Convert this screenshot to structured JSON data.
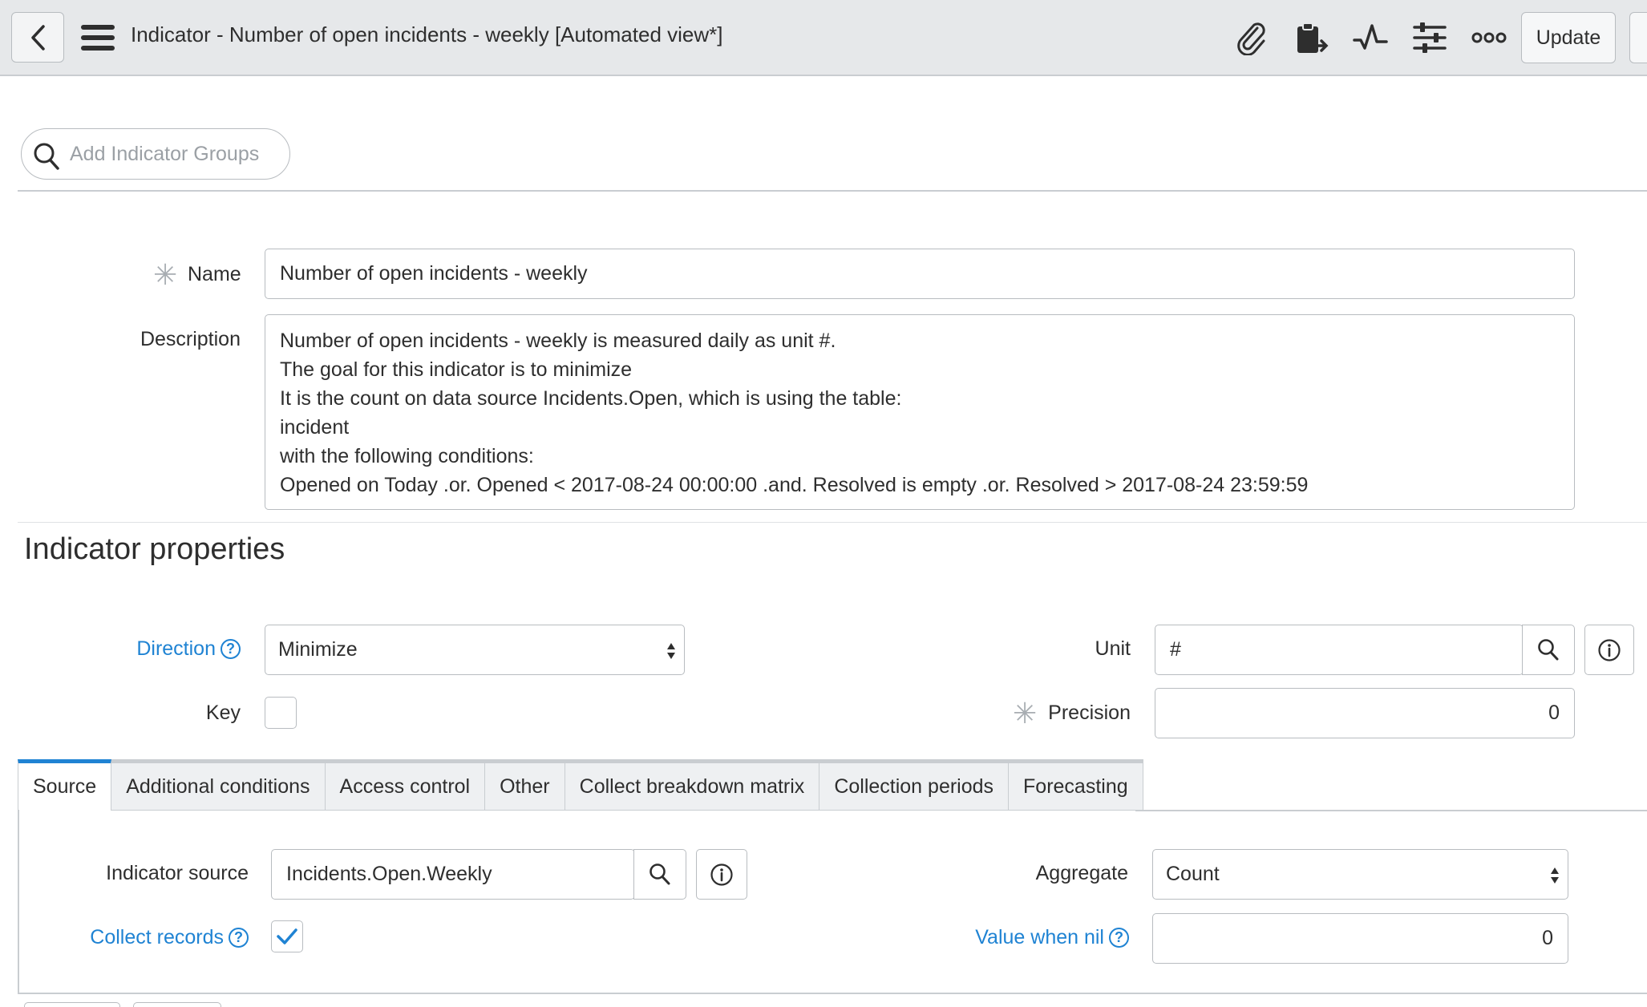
{
  "header": {
    "title": "Indicator - Number of open incidents - weekly",
    "view": "[Automated view*]",
    "update_label": "Update"
  },
  "groups": {
    "placeholder": "Add Indicator Groups"
  },
  "form": {
    "name_label": "Name",
    "name_value": "Number of open incidents - weekly",
    "description_label": "Description",
    "description_lines": [
      "Number of open incidents - weekly is measured daily as unit #.",
      "The goal for this indicator is to minimize",
      "It is the count on data source Incidents.Open, which is using the table:",
      "incident",
      "with the following conditions:",
      "Opened on Today .or. Opened < 2017-08-24 00:00:00 .and. Resolved is empty .or. Resolved > 2017-08-24 23:59:59"
    ]
  },
  "properties": {
    "section_title": "Indicator properties",
    "direction_label": "Direction",
    "direction_value": "Minimize",
    "key_label": "Key",
    "unit_label": "Unit",
    "unit_value": "#",
    "precision_label": "Precision",
    "precision_value": "0"
  },
  "tabs": [
    {
      "label": "Source"
    },
    {
      "label": "Additional conditions"
    },
    {
      "label": "Access control"
    },
    {
      "label": "Other"
    },
    {
      "label": "Collect breakdown matrix"
    },
    {
      "label": "Collection periods"
    },
    {
      "label": "Forecasting"
    }
  ],
  "source": {
    "indicator_source_label": "Indicator source",
    "indicator_source_value": "Incidents.Open.Weekly",
    "aggregate_label": "Aggregate",
    "aggregate_value": "Count",
    "collect_records_label": "Collect records",
    "collect_records_checked": true,
    "value_when_nil_label": "Value when nil",
    "value_when_nil_value": "0"
  },
  "help_glyph": "?",
  "info_glyph": "i",
  "colors": {
    "link": "#1f83d3",
    "header_bg": "#e6e8ea",
    "border": "#b8bcc0"
  }
}
